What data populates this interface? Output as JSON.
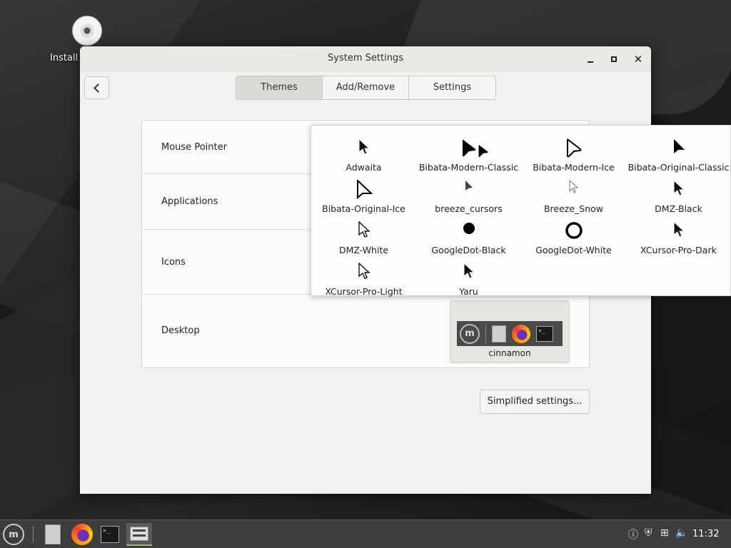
{
  "desktop": {
    "icon_label": "Install"
  },
  "window": {
    "title": "System Settings",
    "tabs": [
      {
        "label": "Themes",
        "active": true
      },
      {
        "label": "Add/Remove",
        "active": false
      },
      {
        "label": "Settings",
        "active": false
      }
    ],
    "rows": [
      {
        "label": "Mouse Pointer"
      },
      {
        "label": "Applications"
      },
      {
        "label": "Icons"
      },
      {
        "label": "Desktop"
      }
    ],
    "desktop_theme": {
      "label": "cinnamon"
    },
    "simplified_button": "Simplified settings..."
  },
  "cursor_popover": {
    "items": [
      {
        "label": "Adwaita",
        "icon": "arrow-black-small"
      },
      {
        "label": "Bibata-Modern-Classic",
        "icon": "arrow-black-round"
      },
      {
        "label": "Bibata-Modern-Ice",
        "icon": "arrow-white-round"
      },
      {
        "label": "Bibata-Original-Classic",
        "icon": "arrow-black-sharp"
      },
      {
        "label": "Bibata-Original-Ice",
        "icon": "arrow-white-sharp"
      },
      {
        "label": "breeze_cursors",
        "icon": "arrow-dark-tiny"
      },
      {
        "label": "Breeze_Snow",
        "icon": "arrow-white-tiny"
      },
      {
        "label": "DMZ-Black",
        "icon": "arrow-black-small"
      },
      {
        "label": "DMZ-White",
        "icon": "arrow-white-small"
      },
      {
        "label": "GoogleDot-Black",
        "icon": "dot-black"
      },
      {
        "label": "GoogleDot-White",
        "icon": "dot-white"
      },
      {
        "label": "XCursor-Pro-Dark",
        "icon": "arrow-black-small"
      },
      {
        "label": "XCursor-Pro-Light",
        "icon": "arrow-white-small"
      },
      {
        "label": "Yaru",
        "icon": "arrow-black-small"
      }
    ]
  },
  "taskbar": {
    "clock": "11:32"
  }
}
